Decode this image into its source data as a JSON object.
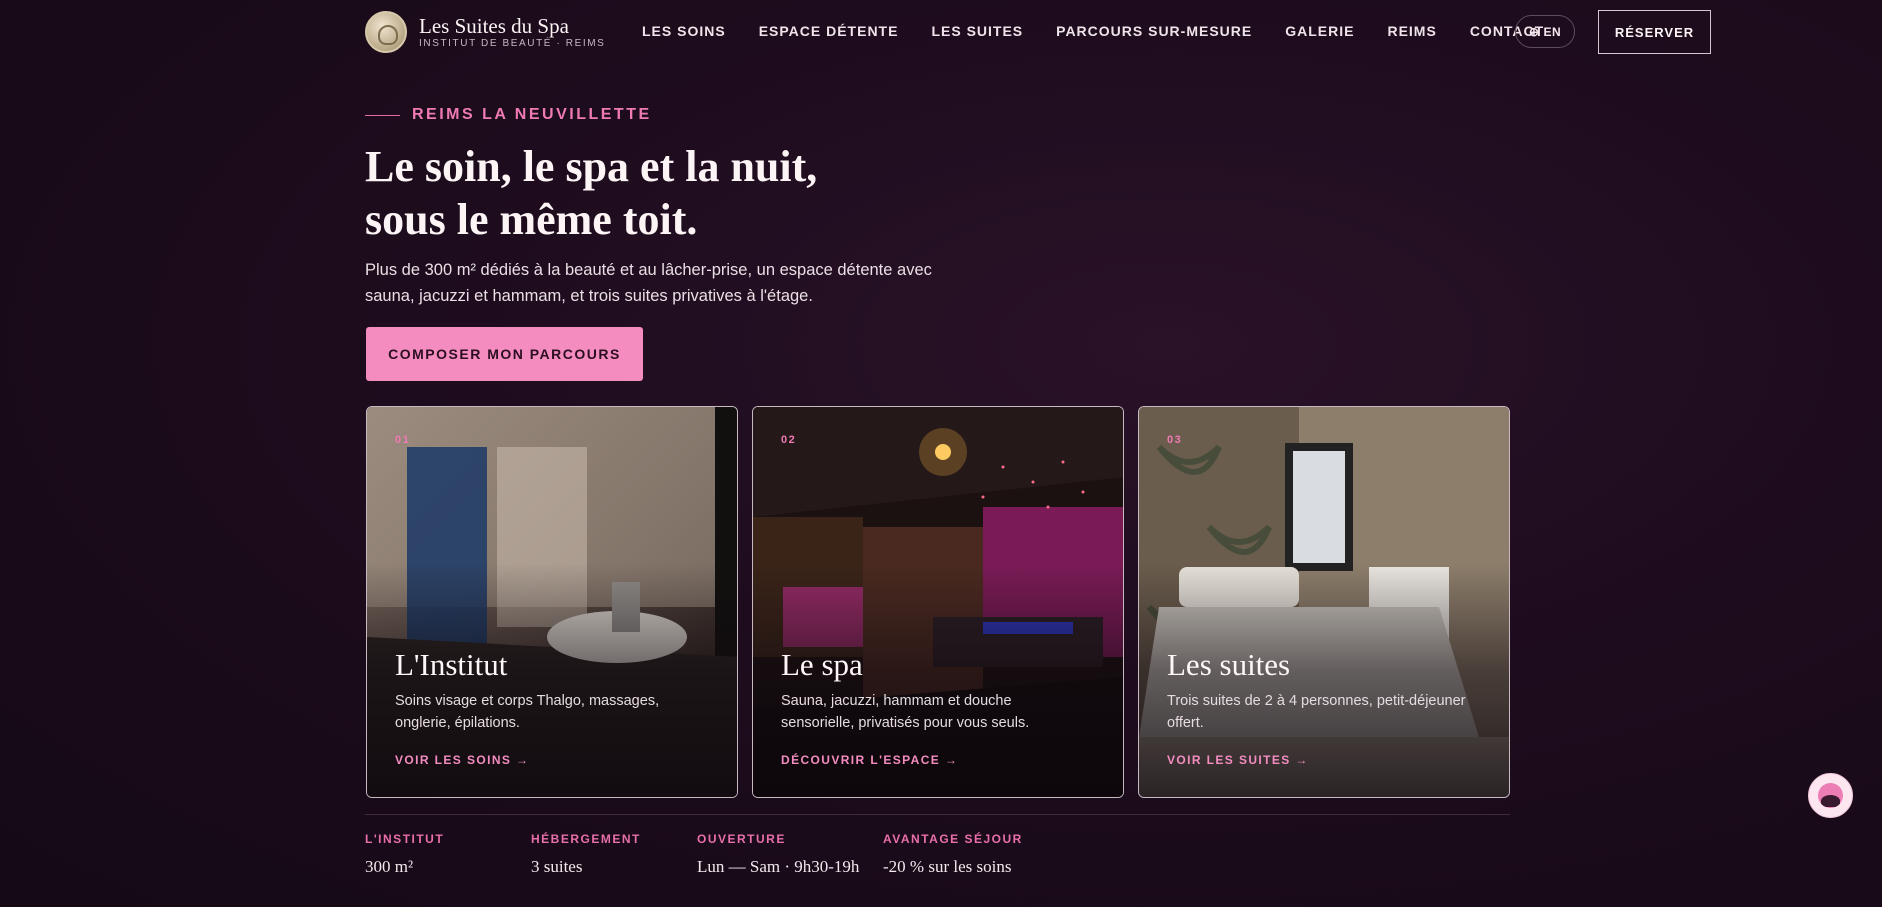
{
  "brand": {
    "title": "Les Suites du Spa",
    "subtitle": "INSTITUT DE BEAUTÉ · REIMS"
  },
  "nav": {
    "items": [
      {
        "label": "LES SOINS"
      },
      {
        "label": "ESPACE DÉTENTE"
      },
      {
        "label": "LES SUITES"
      },
      {
        "label": "PARCOURS SUR-MESURE"
      },
      {
        "label": "GALERIE"
      },
      {
        "label": "REIMS"
      },
      {
        "label": "CONTACT"
      }
    ],
    "lang_label": "EN",
    "reserve_label": "RÉSERVER"
  },
  "hero": {
    "eyebrow": "REIMS LA NEUVILLETTE",
    "headline": "Le soin, le spa et la nuit, sous le même toit.",
    "intro": "Plus de 300 m² dédiés à la beauté et au lâcher-prise, un espace détente avec sauna, jacuzzi et hammam, et trois suites privatives à l'étage.",
    "cta_label": "COMPOSER MON PARCOURS"
  },
  "cards": [
    {
      "num": "01",
      "title": "L'Institut",
      "desc": "Soins visage et corps Thalgo, massages, onglerie, épilations.",
      "link": "VOIR LES SOINS →"
    },
    {
      "num": "02",
      "title": "Le spa",
      "desc": "Sauna, jacuzzi, hammam et douche sensorielle, privatisés pour vous seuls.",
      "link": "DÉCOUVRIR L'ESPACE →"
    },
    {
      "num": "03",
      "title": "Les suites",
      "desc": "Trois suites de 2 à 4 personnes, petit-déjeuner offert.",
      "link": "VOIR LES SUITES →"
    }
  ],
  "stats": [
    {
      "label": "L'INSTITUT",
      "value": "300 m²"
    },
    {
      "label": "HÉBERGEMENT",
      "value": "3 suites"
    },
    {
      "label": "OUVERTURE",
      "value": "Lun — Sam · 9h30-19h"
    },
    {
      "label": "AVANTAGE SÉJOUR",
      "value": "-20 % sur les soins"
    }
  ],
  "colors": {
    "accent": "#f48cc0",
    "background": "#1d0c1d"
  },
  "icons": {
    "lang": "globe-icon",
    "chat": "chat-icon"
  }
}
